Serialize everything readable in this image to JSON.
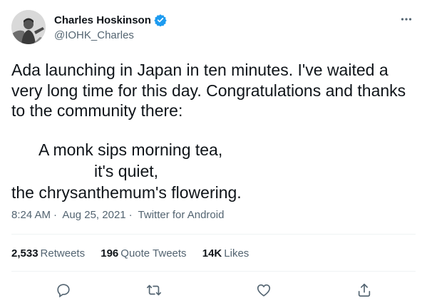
{
  "tweet": {
    "display_name": "Charles Hoskinson",
    "handle": "@IOHK_Charles",
    "verified": true,
    "text": "Ada launching in Japan in ten minutes. I've waited a very long time for this day. Congratulations and thanks to the community there:",
    "poem": [
      "A monk sips morning tea,",
      "it's quiet,",
      "the chrysanthemum's flowering."
    ],
    "time": "8:24 AM",
    "date": "Aug 25, 2021",
    "source": "Twitter for Android",
    "separator": "·"
  },
  "stats": {
    "retweets_count": "2,533",
    "retweets_label": "Retweets",
    "quotes_count": "196",
    "quotes_label": "Quote Tweets",
    "likes_count": "14K",
    "likes_label": "Likes"
  },
  "icons": {
    "verified": "verified-badge-icon",
    "more": "more-dots-icon",
    "reply": "reply-icon",
    "retweet": "retweet-icon",
    "like": "heart-icon",
    "share": "share-icon"
  },
  "colors": {
    "text": "#0f1419",
    "secondary": "#536471",
    "verified_blue": "#1d9bf0",
    "divider": "#eff3f4"
  }
}
